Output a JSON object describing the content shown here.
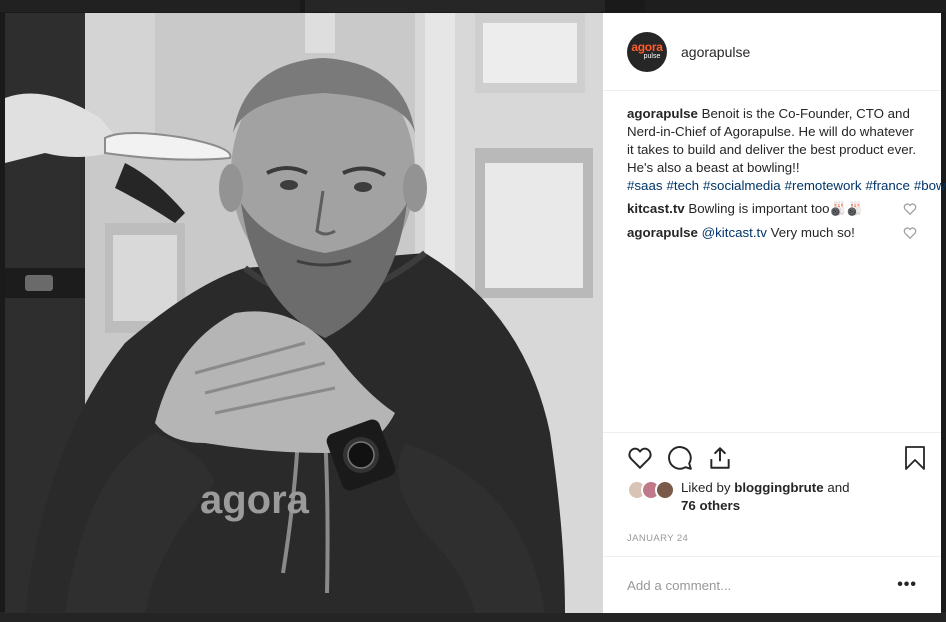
{
  "post": {
    "account": "agorapulse",
    "avatar": {
      "brand_top": "agora",
      "brand_bottom": "pulse",
      "colors": {
        "bg": "#262626",
        "accent": "#ff5c2b"
      }
    },
    "caption": {
      "user": "agorapulse",
      "text": "Benoit is the Co-Founder, CTO and Nerd-in-Chief of Agorapulse. He will do whatever it takes to build and deliver the best product ever. He's also a beast at bowling!!",
      "hashtags": [
        "#saas",
        "#tech",
        "#socialmedia",
        "#remotework",
        "#france",
        "#bowling"
      ]
    },
    "comments": [
      {
        "user": "kitcast.tv",
        "mention": "",
        "text": "Bowling is important too",
        "emoji": "🎳🎳"
      },
      {
        "user": "agorapulse",
        "mention": "@kitcast.tv",
        "text": "Very much so!",
        "emoji": ""
      }
    ],
    "likes": {
      "prefix": "Liked by",
      "user": "bloggingbrute",
      "joiner": "and",
      "others": "76 others"
    },
    "date": "JANUARY 24",
    "add_comment_placeholder": "Add a comment...",
    "more_label": "•••",
    "photo": {
      "shirt_text": "agora"
    },
    "icons": [
      "heart-icon",
      "comment-icon",
      "share-icon",
      "bookmark-icon",
      "more-icon"
    ]
  }
}
